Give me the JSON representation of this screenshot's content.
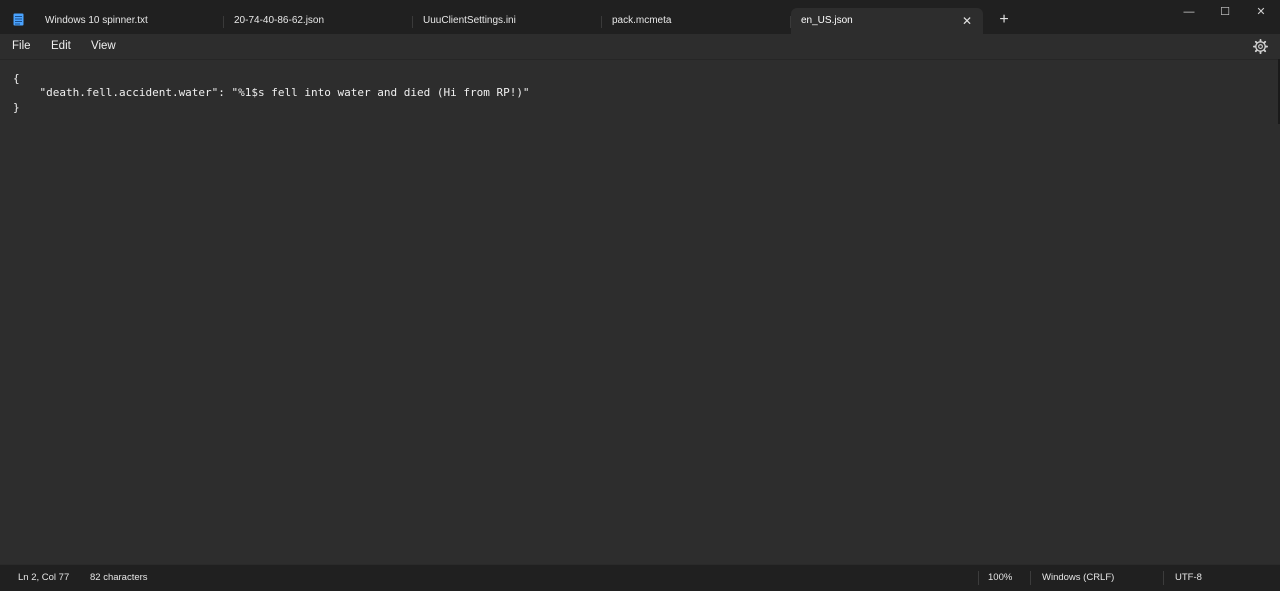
{
  "tabs": [
    {
      "label": "Windows 10 spinner.txt",
      "active": false
    },
    {
      "label": "20-74-40-86-62.json",
      "active": false
    },
    {
      "label": "UuuClientSettings.ini",
      "active": false
    },
    {
      "label": "pack.mcmeta",
      "active": false
    },
    {
      "label": "en_US.json",
      "active": true
    }
  ],
  "tab_close_glyph": "✕",
  "new_tab_glyph": "+",
  "window_controls": {
    "minimize": "—",
    "maximize": "☐",
    "close": "✕"
  },
  "menu": {
    "file": "File",
    "edit": "Edit",
    "view": "View"
  },
  "editor": {
    "lines": [
      "{",
      "    \"death.fell.accident.water\": \"%1$s fell into water and died (Hi from RP!)\"",
      "}"
    ]
  },
  "status": {
    "position": "Ln 2, Col 77",
    "characters": "82 characters",
    "zoom": "100%",
    "line_ending": "Windows (CRLF)",
    "encoding": "UTF-8"
  },
  "icons": {
    "app": "notepad-icon",
    "settings": "gear-icon"
  },
  "colors": {
    "titlebar": "#202020",
    "editor_bg": "#2d2d2d",
    "text": "#f0f0f0",
    "app_icon": "#4aa3ff"
  }
}
